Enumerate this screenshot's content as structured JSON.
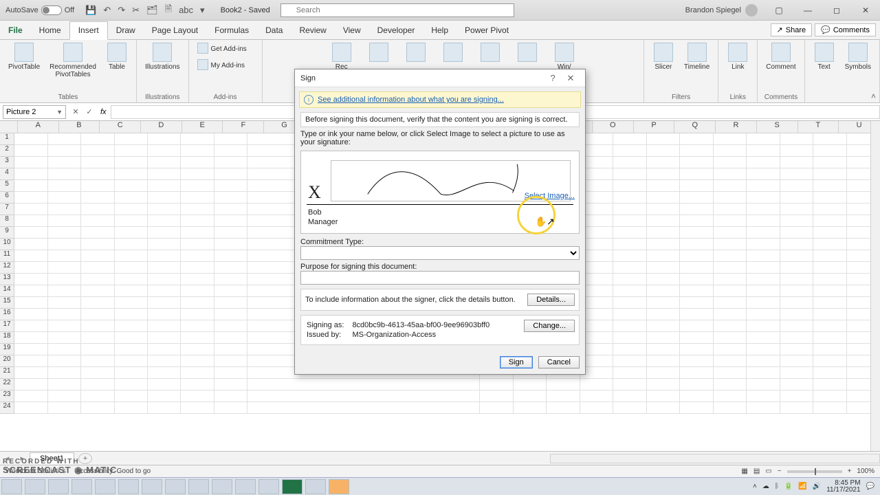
{
  "titlebar": {
    "autosave_label": "AutoSave",
    "autosave_state": "Off",
    "doc": "Book2 - Saved",
    "search_placeholder": "Search",
    "user": "Brandon Spiegel"
  },
  "tabs": [
    "File",
    "Home",
    "Insert",
    "Draw",
    "Page Layout",
    "Formulas",
    "Data",
    "Review",
    "View",
    "Developer",
    "Help",
    "Power Pivot"
  ],
  "active_tab": "Insert",
  "share_label": "Share",
  "comments_label": "Comments",
  "ribbon_groups": {
    "tables": {
      "pivot": "PivotTable",
      "rec": "Recommended\nPivotTables",
      "table": "Table",
      "label": "Tables"
    },
    "illus": {
      "btn": "Illustrations",
      "label": "Illustrations"
    },
    "addins": {
      "get": "Get Add-ins",
      "my": "My Add-ins",
      "label": "Add-ins"
    },
    "rec_charts": "Rec",
    "winloss": "Win/\nloss",
    "filters": {
      "slicer": "Slicer",
      "timeline": "Timeline",
      "label": "Filters"
    },
    "links": {
      "link": "Link",
      "label": "Links"
    },
    "comments": {
      "comment": "Comment",
      "label": "Comments"
    },
    "text": {
      "text": "Text",
      "symbols": "Symbols"
    }
  },
  "namebox": "Picture 2",
  "fx": "fx",
  "columns": [
    "A",
    "B",
    "C",
    "D",
    "E",
    "F",
    "G",
    "",
    "",
    "",
    "",
    "",
    "",
    "O",
    "P",
    "Q",
    "R",
    "S",
    "T",
    "U"
  ],
  "sheet_tab": "Sheet1",
  "status": {
    "left1": "Workbook Statistics",
    "left2": "Accessibility: Good to go",
    "zoom": "100%"
  },
  "watermark": {
    "l1": "RECORDED WITH",
    "l2": "SCREENCAST ◉ MATIC"
  },
  "clock": {
    "time": "8:45 PM",
    "date": "11/17/2021"
  },
  "dialog": {
    "title": "Sign",
    "info_link": "See additional information about what you are signing...",
    "verify": "Before signing this document, verify that the content you are signing is correct.",
    "instr": "Type or ink your name below, or click Select Image to select a picture to use as your signature:",
    "x": "X",
    "select_image": "Select Image...",
    "signer_name": "Bob",
    "signer_title": "Manager",
    "commitment_label": "Commitment Type:",
    "purpose_label": "Purpose for signing this document:",
    "purpose_value": "",
    "details_text": "To include information about the signer, click the details button.",
    "details_btn": "Details...",
    "signing_as_lbl": "Signing as:",
    "signing_as": "8cd0bc9b-4613-45aa-bf00-9ee96903bff0",
    "issued_by_lbl": "Issued by:",
    "issued_by": "MS-Organization-Access",
    "change_btn": "Change...",
    "sign_btn": "Sign",
    "cancel_btn": "Cancel"
  }
}
